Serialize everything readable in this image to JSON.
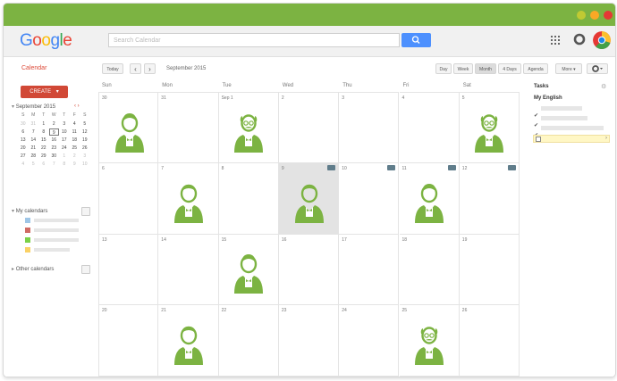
{
  "window": {
    "title_bar_color": "#7cb342",
    "controls": [
      {
        "name": "minimize",
        "color": "#c0ca33"
      },
      {
        "name": "maximize",
        "color": "#f9a825"
      },
      {
        "name": "close",
        "color": "#e53935"
      }
    ]
  },
  "header": {
    "logo": "Google",
    "logo_colors": [
      "#4285f4",
      "#ea4335",
      "#fbbc05",
      "#4285f4",
      "#34a853",
      "#ea4335"
    ],
    "search_placeholder": "Search Calendar"
  },
  "toolbar": {
    "app_name": "Calendar",
    "today_label": "Today",
    "prev_label": "‹",
    "next_label": "›",
    "current_period": "September 2015",
    "views": [
      "Day",
      "Week",
      "Month",
      "4 Days",
      "Agenda"
    ],
    "active_view": "Month",
    "more_label": "More ▾"
  },
  "sidebar": {
    "create_label": "CREATE",
    "mini_calendar": {
      "title": "September 2015",
      "weekday_headers": [
        "S",
        "M",
        "T",
        "W",
        "T",
        "F",
        "S"
      ],
      "weeks": [
        [
          "30",
          "31",
          "1",
          "2",
          "3",
          "4",
          "5"
        ],
        [
          "6",
          "7",
          "8",
          "9",
          "10",
          "11",
          "12"
        ],
        [
          "13",
          "14",
          "15",
          "16",
          "17",
          "18",
          "19"
        ],
        [
          "20",
          "21",
          "22",
          "23",
          "24",
          "25",
          "26"
        ],
        [
          "27",
          "28",
          "29",
          "30",
          "1",
          "2",
          "3"
        ],
        [
          "4",
          "5",
          "6",
          "7",
          "8",
          "9",
          "10"
        ]
      ],
      "today": "9"
    },
    "my_calendars_label": "My calendars",
    "calendar_colors": [
      "#9fc6e7",
      "#d06b64",
      "#7bd148",
      "#fad165"
    ],
    "other_calendars_label": "Other calendars"
  },
  "calendar": {
    "weekday_headers": [
      "Sun",
      "Mon",
      "Tue",
      "Wed",
      "Thu",
      "Fri",
      "Sat"
    ],
    "weeks": [
      [
        "30",
        "31",
        "Sep 1",
        "2",
        "3",
        "4",
        "5"
      ],
      [
        "6",
        "7",
        "8",
        "9",
        "10",
        "11",
        "12"
      ],
      [
        "13",
        "14",
        "15",
        "16",
        "17",
        "18",
        "19"
      ],
      [
        "20",
        "21",
        "22",
        "23",
        "24",
        "25",
        "26"
      ]
    ],
    "today_date": "9",
    "person_icon_color": "#7cb342"
  },
  "tasks": {
    "title": "Tasks",
    "list_name": "My English"
  }
}
